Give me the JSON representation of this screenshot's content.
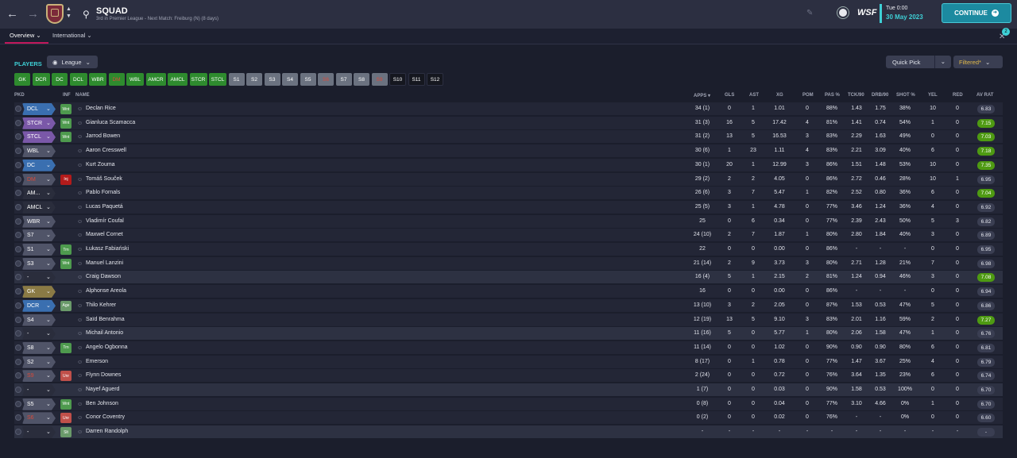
{
  "header": {
    "title": "SQUAD",
    "subtitle": "3rd in Premier League - Next Match: Freiburg (N) (8 days)",
    "time": "Tue 0:00",
    "date": "30 May 2023",
    "continue_label": "CONTINUE",
    "logo_text": "WSF",
    "notification_count": "2"
  },
  "tabs": [
    {
      "label": "Overview"
    },
    {
      "label": "International"
    }
  ],
  "toolbar": {
    "players_label": "PLAYERS",
    "view_dropdown": "League",
    "quick_pick": "Quick Pick",
    "filter": "Filtered*"
  },
  "position_buttons": [
    {
      "label": "GK",
      "color": "#2e8b2e",
      "text": "#fff"
    },
    {
      "label": "DCR",
      "color": "#2e8b2e",
      "text": "#fff"
    },
    {
      "label": "DC",
      "color": "#2e8b2e",
      "text": "#fff"
    },
    {
      "label": "DCL",
      "color": "#2e8b2e",
      "text": "#fff"
    },
    {
      "label": "WBR",
      "color": "#2e8b2e",
      "text": "#fff"
    },
    {
      "label": "DM",
      "color": "#2e8b2e",
      "text": "#d84a3a"
    },
    {
      "label": "WBL",
      "color": "#2e8b2e",
      "text": "#fff"
    },
    {
      "label": "AMCR",
      "color": "#2e8b2e",
      "text": "#fff"
    },
    {
      "label": "AMCL",
      "color": "#2e8b2e",
      "text": "#fff"
    },
    {
      "label": "STCR",
      "color": "#2e8b2e",
      "text": "#fff"
    },
    {
      "label": "STCL",
      "color": "#2e8b2e",
      "text": "#fff"
    },
    {
      "label": "S1",
      "color": "#6b7280",
      "text": "#fff"
    },
    {
      "label": "S2",
      "color": "#6b7280",
      "text": "#fff"
    },
    {
      "label": "S3",
      "color": "#6b7280",
      "text": "#fff"
    },
    {
      "label": "S4",
      "color": "#6b7280",
      "text": "#fff"
    },
    {
      "label": "S5",
      "color": "#6b7280",
      "text": "#fff"
    },
    {
      "label": "S6",
      "color": "#6b7280",
      "text": "#d84a3a"
    },
    {
      "label": "S7",
      "color": "#6b7280",
      "text": "#fff"
    },
    {
      "label": "S8",
      "color": "#6b7280",
      "text": "#fff"
    },
    {
      "label": "S9",
      "color": "#6b7280",
      "text": "#d84a3a"
    },
    {
      "label": "S10",
      "color": "#15171f",
      "text": "#fff"
    },
    {
      "label": "S11",
      "color": "#15171f",
      "text": "#fff"
    },
    {
      "label": "S12",
      "color": "#15171f",
      "text": "#fff"
    }
  ],
  "columns": {
    "pkd": "PKD",
    "inf": "INF",
    "name": "NAME",
    "apps": "APPS",
    "gls": "GLS",
    "ast": "AST",
    "xg": "XG",
    "pom": "POM",
    "pas": "PAS %",
    "tck": "TCK/90",
    "drb": "DRB/90",
    "shot": "SHOT %",
    "yel": "YEL",
    "red": "RED",
    "avrat": "AV RAT"
  },
  "players": [
    {
      "pos": "DCL",
      "posColor": "#3a6fb0",
      "posText": "#fff",
      "inf": "Wnt",
      "infColor": "#4e9a4e",
      "name": "Declan Rice",
      "apps": "34 (1)",
      "gls": "0",
      "ast": "1",
      "xg": "1.01",
      "pom": "0",
      "pas": "88%",
      "tck": "1.43",
      "drb": "1.75",
      "shot": "38%",
      "yel": "10",
      "red": "0",
      "rat": "6.83",
      "ratType": ""
    },
    {
      "pos": "STCR",
      "posColor": "#7a58a8",
      "posText": "#fff",
      "inf": "Wnt",
      "infColor": "#4e9a4e",
      "name": "Gianluca Scamacca",
      "apps": "31 (3)",
      "gls": "16",
      "ast": "5",
      "xg": "17.42",
      "pom": "4",
      "pas": "81%",
      "tck": "1.41",
      "drb": "0.74",
      "shot": "54%",
      "yel": "1",
      "red": "0",
      "rat": "7.15",
      "ratType": "good"
    },
    {
      "pos": "STCL",
      "posColor": "#7a58a8",
      "posText": "#fff",
      "inf": "Wnt",
      "infColor": "#4e9a4e",
      "name": "Jarrod Bowen",
      "apps": "31 (2)",
      "gls": "13",
      "ast": "5",
      "xg": "16.53",
      "pom": "3",
      "pas": "83%",
      "tck": "2.29",
      "drb": "1.63",
      "shot": "49%",
      "yel": "0",
      "red": "0",
      "rat": "7.03",
      "ratType": "good"
    },
    {
      "pos": "WBL",
      "posColor": "#505468",
      "posText": "#fff",
      "inf": "",
      "infColor": "",
      "name": "Aaron Cresswell",
      "apps": "30 (6)",
      "gls": "1",
      "ast": "23",
      "xg": "1.11",
      "pom": "4",
      "pas": "83%",
      "tck": "2.21",
      "drb": "3.09",
      "shot": "40%",
      "yel": "6",
      "red": "0",
      "rat": "7.18",
      "ratType": "good"
    },
    {
      "pos": "DC",
      "posColor": "#3a6fb0",
      "posText": "#fff",
      "inf": "",
      "infColor": "",
      "name": "Kurt Zouma",
      "apps": "30 (1)",
      "gls": "20",
      "ast": "1",
      "xg": "12.99",
      "pom": "3",
      "pas": "86%",
      "tck": "1.51",
      "drb": "1.48",
      "shot": "53%",
      "yel": "10",
      "red": "0",
      "rat": "7.35",
      "ratType": "good"
    },
    {
      "pos": "DM",
      "posColor": "#505468",
      "posText": "#d84a3a",
      "inf": "Inj",
      "infColor": "#b31b1b",
      "name": "Tomáš Souček",
      "apps": "29 (2)",
      "gls": "2",
      "ast": "2",
      "xg": "4.05",
      "pom": "0",
      "pas": "86%",
      "tck": "2.72",
      "drb": "0.46",
      "shot": "28%",
      "yel": "10",
      "red": "1",
      "rat": "6.95",
      "ratType": ""
    },
    {
      "pos": "AM...",
      "posColor": "#2a2d3c",
      "posText": "#fff",
      "inf": "",
      "infColor": "",
      "name": "Pablo Fornals",
      "apps": "26 (6)",
      "gls": "3",
      "ast": "7",
      "xg": "5.47",
      "pom": "1",
      "pas": "82%",
      "tck": "2.52",
      "drb": "0.80",
      "shot": "36%",
      "yel": "6",
      "red": "0",
      "rat": "7.04",
      "ratType": "good"
    },
    {
      "pos": "AMCL",
      "posColor": "#2a2d3c",
      "posText": "#fff",
      "inf": "",
      "infColor": "",
      "name": "Lucas Paquetá",
      "apps": "25 (5)",
      "gls": "3",
      "ast": "1",
      "xg": "4.78",
      "pom": "0",
      "pas": "77%",
      "tck": "3.46",
      "drb": "1.24",
      "shot": "36%",
      "yel": "4",
      "red": "0",
      "rat": "6.92",
      "ratType": ""
    },
    {
      "pos": "WBR",
      "posColor": "#505468",
      "posText": "#fff",
      "inf": "",
      "infColor": "",
      "name": "Vladimír Coufal",
      "apps": "25",
      "gls": "0",
      "ast": "6",
      "xg": "0.34",
      "pom": "0",
      "pas": "77%",
      "tck": "2.39",
      "drb": "2.43",
      "shot": "50%",
      "yel": "5",
      "red": "3",
      "rat": "6.82",
      "ratType": ""
    },
    {
      "pos": "S7",
      "posColor": "#505468",
      "posText": "#fff",
      "inf": "",
      "infColor": "",
      "name": "Maxwel Cornet",
      "apps": "24 (10)",
      "gls": "2",
      "ast": "7",
      "xg": "1.87",
      "pom": "1",
      "pas": "80%",
      "tck": "2.80",
      "drb": "1.84",
      "shot": "40%",
      "yel": "3",
      "red": "0",
      "rat": "6.89",
      "ratType": ""
    },
    {
      "pos": "S1",
      "posColor": "#505468",
      "posText": "#fff",
      "inf": "Trn",
      "infColor": "#4e9a4e",
      "name": "Łukasz Fabiański",
      "apps": "22",
      "gls": "0",
      "ast": "0",
      "xg": "0.00",
      "pom": "0",
      "pas": "86%",
      "tck": "-",
      "drb": "-",
      "shot": "-",
      "yel": "0",
      "red": "0",
      "rat": "6.95",
      "ratType": ""
    },
    {
      "pos": "S3",
      "posColor": "#505468",
      "posText": "#fff",
      "inf": "Wnt",
      "infColor": "#4e9a4e",
      "name": "Manuel Lanzini",
      "apps": "21 (14)",
      "gls": "2",
      "ast": "9",
      "xg": "3.73",
      "pom": "3",
      "pas": "80%",
      "tck": "2.71",
      "drb": "1.28",
      "shot": "21%",
      "yel": "7",
      "red": "0",
      "rat": "6.98",
      "ratType": ""
    },
    {
      "pos": "-",
      "posColor": "#2a2d3c",
      "posText": "#fff",
      "inf": "",
      "infColor": "",
      "name": "Craig Dawson",
      "apps": "16 (4)",
      "gls": "5",
      "ast": "1",
      "xg": "2.15",
      "pom": "2",
      "pas": "81%",
      "tck": "1.24",
      "drb": "0.94",
      "shot": "46%",
      "yel": "3",
      "red": "0",
      "rat": "7.08",
      "ratType": "good",
      "alt": true
    },
    {
      "pos": "GK",
      "posColor": "#8a7a45",
      "posText": "#fff",
      "inf": "",
      "infColor": "",
      "name": "Alphonse Areola",
      "apps": "16",
      "gls": "0",
      "ast": "0",
      "xg": "0.00",
      "pom": "0",
      "pas": "86%",
      "tck": "-",
      "drb": "-",
      "shot": "-",
      "yel": "0",
      "red": "0",
      "rat": "6.94",
      "ratType": ""
    },
    {
      "pos": "DCR",
      "posColor": "#3a6fb0",
      "posText": "#fff",
      "inf": "Age",
      "infColor": "#6a9a6a",
      "name": "Thilo Kehrer",
      "apps": "13 (10)",
      "gls": "3",
      "ast": "2",
      "xg": "2.05",
      "pom": "0",
      "pas": "87%",
      "tck": "1.53",
      "drb": "0.53",
      "shot": "47%",
      "yel": "5",
      "red": "0",
      "rat": "6.86",
      "ratType": ""
    },
    {
      "pos": "S4",
      "posColor": "#505468",
      "posText": "#fff",
      "inf": "",
      "infColor": "",
      "name": "Saïd Benrahma",
      "apps": "12 (19)",
      "gls": "13",
      "ast": "5",
      "xg": "9.10",
      "pom": "3",
      "pas": "83%",
      "tck": "2.01",
      "drb": "1.16",
      "shot": "59%",
      "yel": "2",
      "red": "0",
      "rat": "7.27",
      "ratType": "good"
    },
    {
      "pos": "-",
      "posColor": "#2a2d3c",
      "posText": "#fff",
      "inf": "",
      "infColor": "",
      "name": "Michail Antonio",
      "apps": "11 (16)",
      "gls": "5",
      "ast": "0",
      "xg": "5.77",
      "pom": "1",
      "pas": "80%",
      "tck": "2.06",
      "drb": "1.58",
      "shot": "47%",
      "yel": "1",
      "red": "0",
      "rat": "6.76",
      "ratType": "",
      "alt": true
    },
    {
      "pos": "S8",
      "posColor": "#505468",
      "posText": "#fff",
      "inf": "Trn",
      "infColor": "#4e9a4e",
      "name": "Angelo Ogbonna",
      "apps": "11 (14)",
      "gls": "0",
      "ast": "0",
      "xg": "1.02",
      "pom": "0",
      "pas": "90%",
      "tck": "0.90",
      "drb": "0.90",
      "shot": "80%",
      "yel": "6",
      "red": "0",
      "rat": "6.81",
      "ratType": ""
    },
    {
      "pos": "S2",
      "posColor": "#505468",
      "posText": "#fff",
      "inf": "",
      "infColor": "",
      "name": "Emerson",
      "apps": "8 (17)",
      "gls": "0",
      "ast": "1",
      "xg": "0.78",
      "pom": "0",
      "pas": "77%",
      "tck": "1.47",
      "drb": "3.67",
      "shot": "25%",
      "yel": "4",
      "red": "0",
      "rat": "6.79",
      "ratType": ""
    },
    {
      "pos": "S9",
      "posColor": "#505468",
      "posText": "#d84a3a",
      "inf": "Unr",
      "infColor": "#c0504a",
      "name": "Flynn Downes",
      "apps": "2 (24)",
      "gls": "0",
      "ast": "0",
      "xg": "0.72",
      "pom": "0",
      "pas": "76%",
      "tck": "3.64",
      "drb": "1.35",
      "shot": "23%",
      "yel": "6",
      "red": "0",
      "rat": "6.74",
      "ratType": ""
    },
    {
      "pos": "-",
      "posColor": "#2a2d3c",
      "posText": "#fff",
      "inf": "",
      "infColor": "",
      "name": "Nayef Aguerd",
      "apps": "1 (7)",
      "gls": "0",
      "ast": "0",
      "xg": "0.03",
      "pom": "0",
      "pas": "90%",
      "tck": "1.58",
      "drb": "0.53",
      "shot": "100%",
      "yel": "0",
      "red": "0",
      "rat": "6.70",
      "ratType": "",
      "alt": true
    },
    {
      "pos": "S5",
      "posColor": "#505468",
      "posText": "#fff",
      "inf": "Wnt",
      "infColor": "#4e9a4e",
      "name": "Ben Johnson",
      "apps": "0 (8)",
      "gls": "0",
      "ast": "0",
      "xg": "0.04",
      "pom": "0",
      "pas": "77%",
      "tck": "3.10",
      "drb": "4.66",
      "shot": "0%",
      "yel": "1",
      "red": "0",
      "rat": "6.70",
      "ratType": ""
    },
    {
      "pos": "S6",
      "posColor": "#505468",
      "posText": "#d84a3a",
      "inf": "Unr",
      "infColor": "#c0504a",
      "name": "Conor Coventry",
      "apps": "0 (2)",
      "gls": "0",
      "ast": "0",
      "xg": "0.02",
      "pom": "0",
      "pas": "76%",
      "tck": "-",
      "drb": "-",
      "shot": "0%",
      "yel": "0",
      "red": "0",
      "rat": "6.60",
      "ratType": ""
    },
    {
      "pos": "-",
      "posColor": "#2a2d3c",
      "posText": "#fff",
      "inf": "Slt",
      "infColor": "#6a9a6a",
      "name": "Darren Randolph",
      "apps": "-",
      "gls": "-",
      "ast": "-",
      "xg": "-",
      "pom": "-",
      "pas": "-",
      "tck": "-",
      "drb": "-",
      "shot": "-",
      "yel": "-",
      "red": "-",
      "rat": "-",
      "ratType": "",
      "alt": true
    }
  ]
}
